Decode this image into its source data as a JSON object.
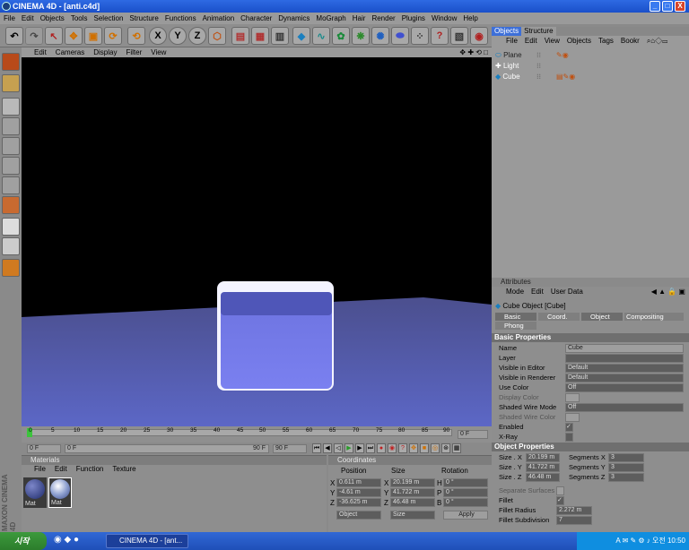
{
  "window": {
    "title": "CINEMA 4D - [anti.c4d]",
    "min": "_",
    "max": "□",
    "close": "X"
  },
  "menu": [
    "File",
    "Edit",
    "Objects",
    "Tools",
    "Selection",
    "Structure",
    "Functions",
    "Animation",
    "Character",
    "Dynamics",
    "MoGraph",
    "Hair",
    "Render",
    "Plugins",
    "Window",
    "Help"
  ],
  "toolbar": {
    "x_label": "X",
    "y_label": "Y",
    "z_label": "Z",
    "help_label": "?"
  },
  "viewport_menu": [
    "Edit",
    "Cameras",
    "Display",
    "Filter",
    "View"
  ],
  "viewport_nav": "✥ ✚ ⟲ □",
  "timeline": {
    "ticks": [
      "0",
      "5",
      "10",
      "15",
      "20",
      "25",
      "30",
      "35",
      "40",
      "45",
      "50",
      "55",
      "60",
      "65",
      "70",
      "75",
      "80",
      "85",
      "90"
    ],
    "current_frame": "0 F"
  },
  "playback": {
    "start": "0 F",
    "range_start": "0 F",
    "range_end": "90 F",
    "end": "90 F"
  },
  "materials": {
    "title": "Materials",
    "menu": [
      "File",
      "Edit",
      "Function",
      "Texture"
    ],
    "items": [
      {
        "name": "Mat"
      },
      {
        "name": "Mat"
      }
    ]
  },
  "coordinates": {
    "title": "Coordinates",
    "headers": [
      "Position",
      "Size",
      "Rotation"
    ],
    "rows": [
      {
        "axis": "X",
        "pos": "0.611 m",
        "size_axis": "X",
        "size": "20.199 m",
        "rot_axis": "H",
        "rot": "0 °"
      },
      {
        "axis": "Y",
        "pos": "-4.61 m",
        "size_axis": "Y",
        "size": "41.722 m",
        "rot_axis": "P",
        "rot": "0 °"
      },
      {
        "axis": "Z",
        "pos": "-36.625 m",
        "size_axis": "Z",
        "size": "46.48 m",
        "rot_axis": "B",
        "rot": "0 °"
      }
    ],
    "mode": "Object",
    "size_mode": "Size",
    "apply": "Apply"
  },
  "object_manager": {
    "tabs": [
      "Objects",
      "Structure"
    ],
    "menu": [
      "File",
      "Edit",
      "View",
      "Objects",
      "Tags",
      "Bookr"
    ],
    "objects": [
      {
        "name": "Plane"
      },
      {
        "name": "Light"
      },
      {
        "name": "Cube"
      }
    ]
  },
  "attributes": {
    "title": "Attributes",
    "menu": [
      "Mode",
      "Edit",
      "User Data"
    ],
    "object_title": "Cube Object [Cube]",
    "tabs": [
      "Basic",
      "Coord.",
      "Object",
      "Compositing",
      "Phong"
    ],
    "basic_header": "Basic Properties",
    "basic": [
      {
        "label": "Name",
        "value": "Cube"
      },
      {
        "label": "Layer",
        "value": ""
      },
      {
        "label": "Visible in Editor",
        "value": "Default"
      },
      {
        "label": "Visible in Renderer",
        "value": "Default"
      },
      {
        "label": "Use Color",
        "value": "Off"
      },
      {
        "label": "Display Color",
        "value": ""
      },
      {
        "label": "Shaded Wire Mode",
        "value": "Off"
      },
      {
        "label": "Shaded Wire Color",
        "value": ""
      },
      {
        "label": "Enabled",
        "value": "✓"
      },
      {
        "label": "X-Ray",
        "value": ""
      }
    ],
    "object_header": "Object Properties",
    "object_props": [
      {
        "label": "Size . X",
        "value": "20.199 m",
        "seg_label": "Segments X",
        "seg": "3"
      },
      {
        "label": "Size . Y",
        "value": "41.722 m",
        "seg_label": "Segments Y",
        "seg": "3"
      },
      {
        "label": "Size . Z",
        "value": "46.48 m",
        "seg_label": "Segments Z",
        "seg": "3"
      }
    ],
    "separate_surfaces": "Separate Surfaces",
    "fillet": "Fillet",
    "fillet_check": "✓",
    "fillet_radius": {
      "label": "Fillet Radius",
      "value": "2.272 m"
    },
    "fillet_subdivision": {
      "label": "Fillet Subdivision",
      "value": "7"
    }
  },
  "taskbar": {
    "start": "시작",
    "task": "CINEMA 4D - [ant...",
    "clock": "오전 10:50",
    "tray_lang": "A"
  },
  "branding": "MAXON CINEMA 4D"
}
